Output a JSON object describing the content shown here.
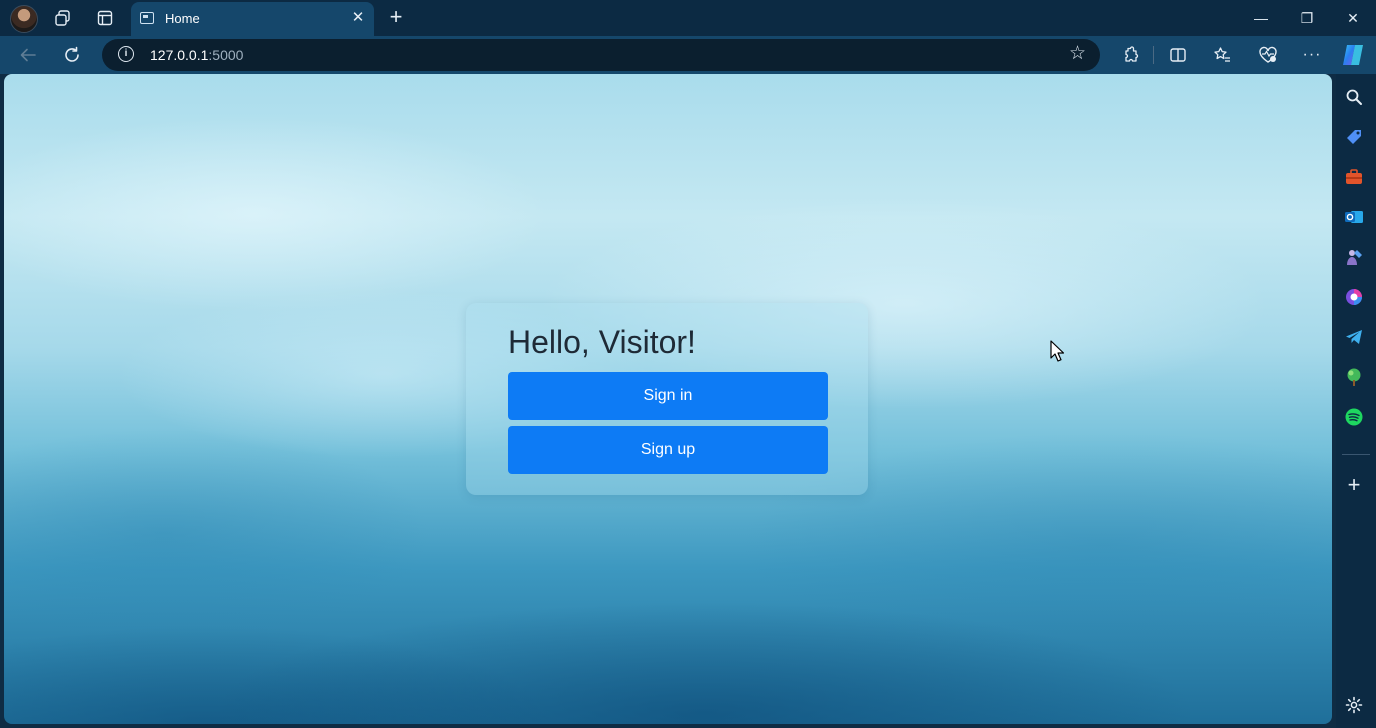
{
  "tab": {
    "title": "Home",
    "close": "✕"
  },
  "newtab": "+",
  "window": {
    "minimize": "—",
    "restore": "❐",
    "close": "✕"
  },
  "address": {
    "host": "127.0.0.1",
    "port": ":5000"
  },
  "page": {
    "heading": "Hello, Visitor!",
    "sign_in_label": "Sign in",
    "sign_up_label": "Sign up"
  },
  "colors": {
    "primary_button": "#0d7bf5",
    "tab_active": "#15476b",
    "frame": "#0c2a43"
  },
  "sidebar_icons": [
    "search-icon",
    "shopping-tag-icon",
    "tools-icon",
    "outlook-icon",
    "games-icon",
    "copilot-icon",
    "telegram-icon",
    "tree-icon",
    "spotify-icon",
    "add-icon",
    "settings-icon"
  ],
  "more": "···"
}
